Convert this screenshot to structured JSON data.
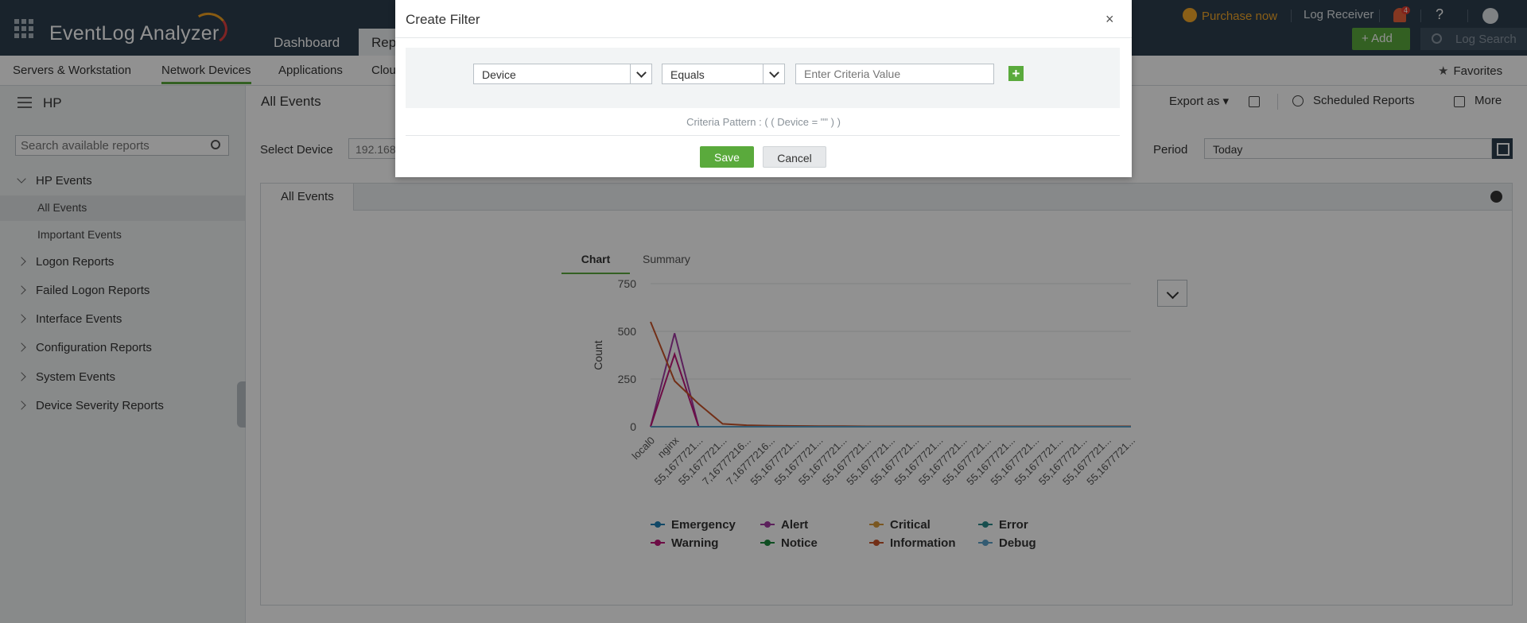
{
  "app": {
    "brand": "EventLog Analyzer",
    "tabs": [
      "Dashboard",
      "Rep"
    ],
    "purchase": "Purchase now",
    "log_receiver": "Log Receiver",
    "notification_count": "4",
    "help": "?",
    "add_label": "Add",
    "log_search": "Log Search"
  },
  "subnav": {
    "items": [
      "Servers & Workstation",
      "Network Devices",
      "Applications",
      "Clou"
    ],
    "favorites": "Favorites"
  },
  "sidebar": {
    "title": "HP",
    "search_placeholder": "Search available reports",
    "items": [
      {
        "label": "HP Events"
      },
      {
        "label": "All Events"
      },
      {
        "label": "Important Events"
      },
      {
        "label": "Logon Reports"
      },
      {
        "label": "Failed Logon Reports"
      },
      {
        "label": "Interface Events"
      },
      {
        "label": "Configuration Reports"
      },
      {
        "label": "System Events"
      },
      {
        "label": "Device Severity Reports"
      }
    ]
  },
  "main": {
    "title": "All Events",
    "export_as": "Export as",
    "scheduled_reports": "Scheduled Reports",
    "more": "More",
    "select_device_label": "Select Device",
    "device_value": "192.168",
    "period_label": "Period",
    "period_value": "Today",
    "report_tab": "All Events",
    "chart_tab": "Chart",
    "summary_tab": "Summary"
  },
  "modal": {
    "title": "Create Filter",
    "close": "×",
    "field_select": "Device",
    "operator_select": "Equals",
    "value_placeholder": "Enter Criteria Value",
    "plus": "+",
    "criteria_pattern": "Criteria Pattern : ( ( Device = \"\" ) )",
    "save": "Save",
    "cancel": "Cancel"
  },
  "chart_data": {
    "type": "line",
    "ylabel": "Count",
    "ylim": [
      0,
      750
    ],
    "yticks": [
      0,
      250,
      500,
      750
    ],
    "categories": [
      "local0",
      "nginx",
      "55,1677721...",
      "55,1677721...",
      "7,16777216...",
      "7,16777216...",
      "55,1677721...",
      "55,1677721...",
      "55,1677721...",
      "55,1677721...",
      "55,1677721...",
      "55,1677721...",
      "55,1677721...",
      "55,1677721...",
      "55,1677721...",
      "55,1677721...",
      "55,1677721...",
      "55,1677721...",
      "55,1677721...",
      "55,1677721...",
      "55,1677721..."
    ],
    "series": [
      {
        "name": "Emergency",
        "color": "#1f7fb5",
        "values": [
          0,
          0,
          0,
          0,
          0,
          0,
          0,
          0,
          0,
          0,
          0,
          0,
          0,
          0,
          0,
          0,
          0,
          0,
          0,
          0,
          0
        ]
      },
      {
        "name": "Alert",
        "color": "#a23ba3",
        "values": [
          0,
          490,
          0,
          0,
          0,
          0,
          0,
          0,
          0,
          0,
          0,
          0,
          0,
          0,
          0,
          0,
          0,
          0,
          0,
          0,
          0
        ]
      },
      {
        "name": "Critical",
        "color": "#d69a3a",
        "values": [
          0,
          0,
          0,
          0,
          0,
          0,
          0,
          0,
          0,
          0,
          0,
          0,
          0,
          0,
          0,
          0,
          0,
          0,
          0,
          0,
          0
        ]
      },
      {
        "name": "Error",
        "color": "#2a8a8a",
        "values": [
          0,
          0,
          0,
          0,
          0,
          0,
          0,
          0,
          0,
          0,
          0,
          0,
          0,
          0,
          0,
          0,
          0,
          0,
          0,
          0,
          0
        ]
      },
      {
        "name": "Warning",
        "color": "#c0167a",
        "values": [
          0,
          380,
          0,
          0,
          0,
          0,
          0,
          0,
          0,
          0,
          0,
          0,
          0,
          0,
          0,
          0,
          0,
          0,
          0,
          0,
          0
        ]
      },
      {
        "name": "Notice",
        "color": "#1c8a3c",
        "values": [
          0,
          0,
          0,
          0,
          0,
          0,
          0,
          0,
          0,
          0,
          0,
          0,
          0,
          0,
          0,
          0,
          0,
          0,
          0,
          0,
          0
        ]
      },
      {
        "name": "Information",
        "color": "#c8532a",
        "values": [
          550,
          240,
          120,
          15,
          8,
          5,
          4,
          3,
          3,
          2,
          2,
          2,
          2,
          2,
          2,
          2,
          2,
          2,
          2,
          2,
          2
        ]
      },
      {
        "name": "Debug",
        "color": "#5aa0c8",
        "values": [
          0,
          0,
          0,
          0,
          0,
          0,
          0,
          0,
          0,
          0,
          0,
          0,
          0,
          0,
          0,
          0,
          0,
          0,
          0,
          0,
          0
        ]
      }
    ]
  }
}
